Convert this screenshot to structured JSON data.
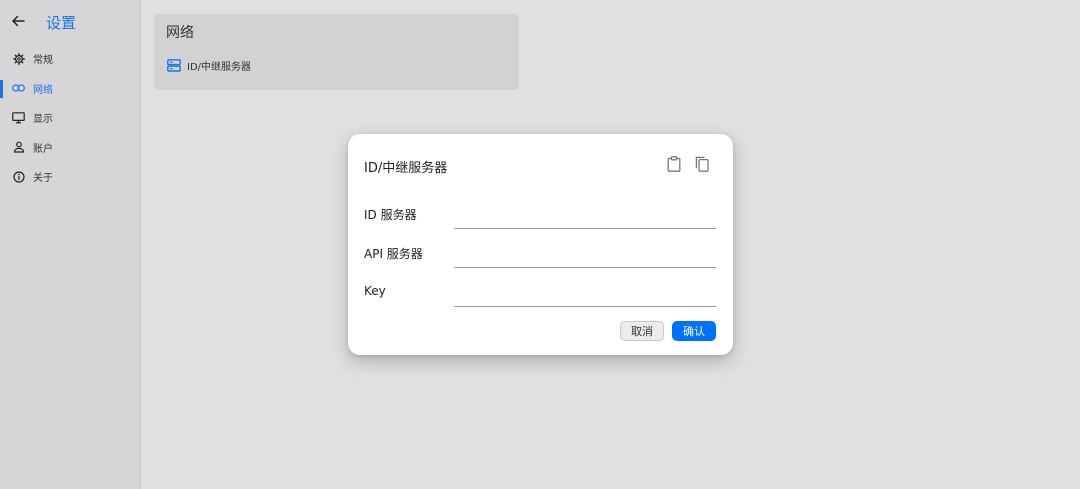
{
  "sidebar": {
    "title": "设置",
    "items": [
      {
        "label": "常规",
        "icon": "gear-icon"
      },
      {
        "label": "网络",
        "icon": "link-icon",
        "active": true
      },
      {
        "label": "显示",
        "icon": "monitor-icon"
      },
      {
        "label": "账户",
        "icon": "person-icon"
      },
      {
        "label": "关于",
        "icon": "info-icon"
      }
    ]
  },
  "network_card": {
    "title": "网络",
    "item_label": "ID/中继服务器",
    "item_icon": "server-icon"
  },
  "dialog": {
    "title": "ID/中继服务器",
    "fields": [
      {
        "label": "ID 服务器",
        "value": ""
      },
      {
        "label": "API 服务器",
        "value": ""
      },
      {
        "label": "Key",
        "value": ""
      }
    ],
    "cancel_label": "取消",
    "ok_label": "确认"
  },
  "colors": {
    "accent": "#1a73e8",
    "ok_button": "#0071ff",
    "sidebar_bg": "#d6d6d8",
    "page_bg": "#e0e0e0"
  }
}
